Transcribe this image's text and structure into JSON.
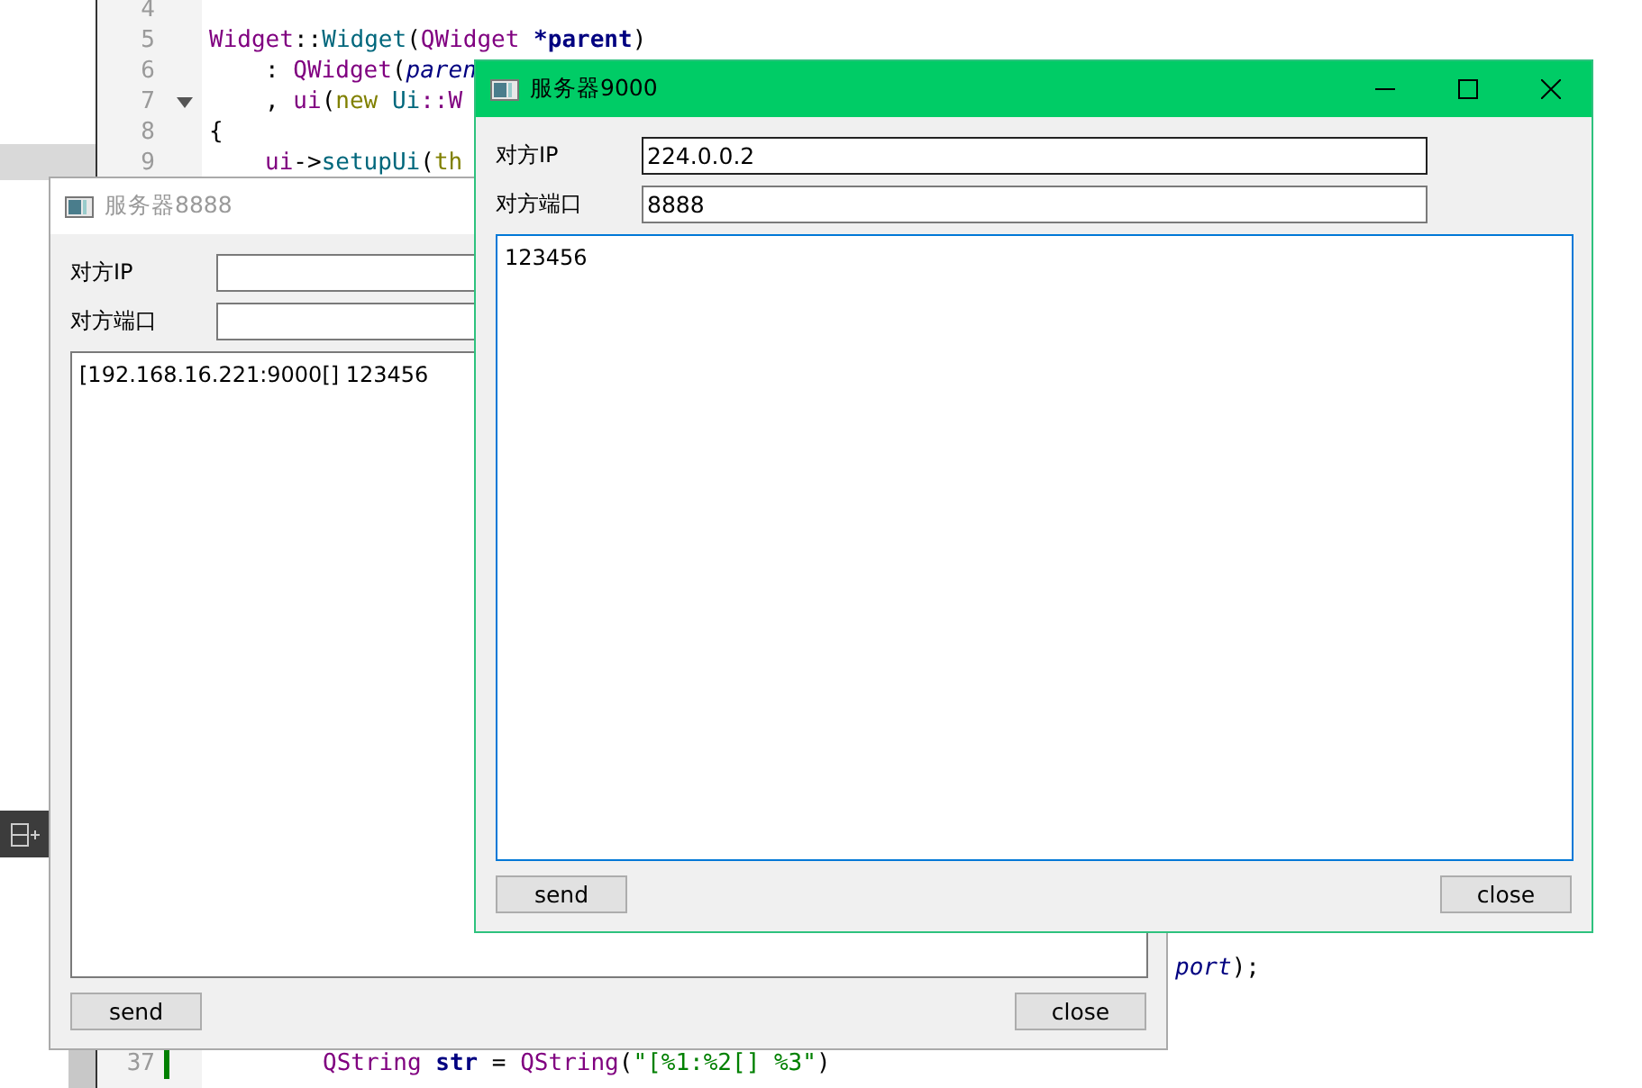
{
  "editor": {
    "top_lines": [
      {
        "number": "4",
        "kind": "top"
      },
      {
        "number": "5",
        "kind": "top",
        "tokens": [
          {
            "text": "Widget",
            "kind": "type"
          },
          {
            "text": "::",
            "kind": "plain"
          },
          {
            "text": "Widget",
            "kind": "func"
          },
          {
            "text": "(",
            "kind": "plain"
          },
          {
            "text": "QWidget",
            "kind": "type"
          },
          {
            "text": " *parent",
            "kind": "bold"
          },
          {
            "text": ")",
            "kind": "plain"
          }
        ]
      },
      {
        "number": "6",
        "kind": "body",
        "tokens": [
          {
            "text": ": ",
            "kind": "plain"
          },
          {
            "text": "QWidget",
            "kind": "type"
          },
          {
            "text": "(",
            "kind": "plain"
          },
          {
            "text": "paren",
            "kind": "italic"
          }
        ]
      },
      {
        "number": "7",
        "kind": "body",
        "fold": true,
        "tokens": [
          {
            "text": ", ",
            "kind": "plain"
          },
          {
            "text": "ui",
            "kind": "type"
          },
          {
            "text": "(",
            "kind": "plain"
          },
          {
            "text": "new",
            "kind": "keyword"
          },
          {
            "text": " Ui",
            "kind": "func"
          },
          {
            "text": "::W",
            "kind": "type"
          }
        ]
      },
      {
        "number": "8",
        "kind": "top",
        "tokens": [
          {
            "text": "{",
            "kind": "plain"
          }
        ]
      },
      {
        "number": "9",
        "kind": "body",
        "tokens": [
          {
            "text": "ui",
            "kind": "type"
          },
          {
            "text": "->",
            "kind": "plain"
          },
          {
            "text": "setupUi",
            "kind": "func"
          },
          {
            "text": "(",
            "kind": "plain"
          },
          {
            "text": "th",
            "kind": "keyword"
          }
        ]
      }
    ],
    "bottom_lines": [
      {
        "kind": "continuation",
        "tokens": [
          {
            "text": "port",
            "kind": "italic"
          },
          {
            "text": ");",
            "kind": "plain"
          }
        ]
      },
      {
        "number": "37",
        "kind": "nested",
        "modified": true,
        "tokens": [
          {
            "text": "QString",
            "kind": "type"
          },
          {
            "text": " str",
            "kind": "bold"
          },
          {
            "text": " = ",
            "kind": "plain"
          },
          {
            "text": "QString",
            "kind": "type"
          },
          {
            "text": "(",
            "kind": "plain"
          },
          {
            "text": "\"[%1:%2[] %3\"",
            "kind": "string"
          },
          {
            "text": ")",
            "kind": "plain"
          }
        ]
      }
    ]
  },
  "windows": [
    {
      "title": "服务器8888",
      "active": false,
      "ip_label": "对方IP",
      "port_label": "对方端口",
      "ip_field": {
        "highlighted": false
      },
      "log": {
        "text": "[192.168.16.221:9000[] 123456",
        "focused": false
      },
      "send_button": "send",
      "close_button": "close"
    },
    {
      "title": "服务器9000",
      "active": true,
      "ip_label": "对方IP",
      "port_label": "对方端口",
      "ip_field": {
        "value": "224.0.0.2",
        "highlighted": true
      },
      "port_field": {
        "value": "8888"
      },
      "log": {
        "text": "123456",
        "focused": true
      },
      "send_button": "send",
      "close_button": "close"
    }
  ]
}
